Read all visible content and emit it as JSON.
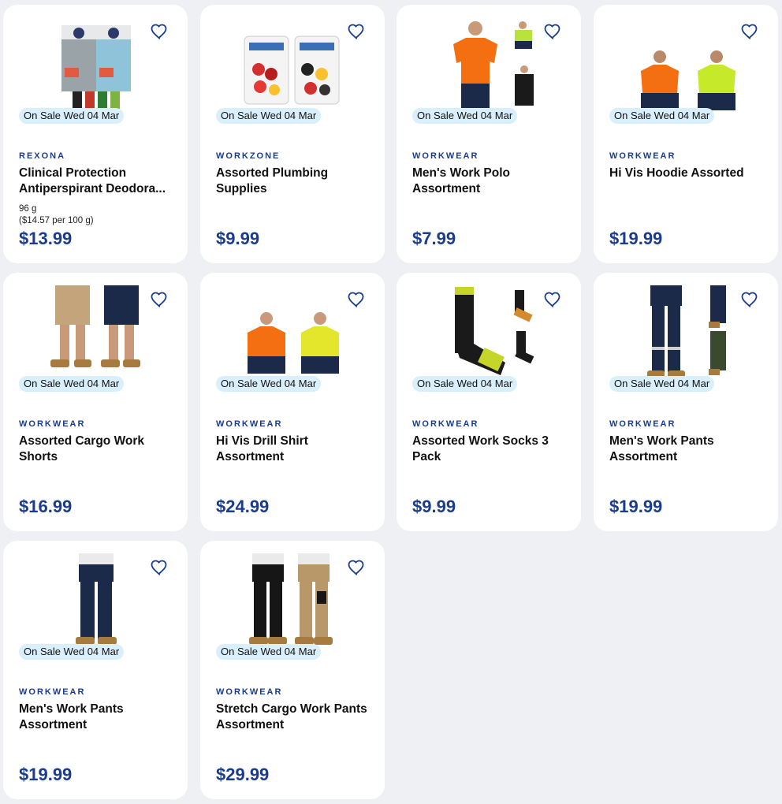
{
  "badge_text": "On Sale Wed 04 Mar",
  "products": [
    {
      "brand": "REXONA",
      "title": "Clinical Protection Antiperspirant Deodora...",
      "size": "96 g",
      "unit_price": "($14.57 per 100 g)",
      "price": "$13.99",
      "image": "deodorant-boxes"
    },
    {
      "brand": "WORKZONE",
      "title": "Assorted Plumbing Supplies",
      "price": "$9.99",
      "image": "tap-repair-kits"
    },
    {
      "brand": "WORKWEAR",
      "title": "Men's Work Polo Assortment",
      "price": "$7.99",
      "image": "hi-vis-polo"
    },
    {
      "brand": "WORKWEAR",
      "title": "Hi Vis Hoodie Assorted",
      "price": "$19.99",
      "image": "hi-vis-hoodies"
    },
    {
      "brand": "WORKWEAR",
      "title": "Assorted Cargo Work Shorts",
      "price": "$16.99",
      "image": "cargo-shorts"
    },
    {
      "brand": "WORKWEAR",
      "title": "Hi Vis Drill Shirt Assortment",
      "price": "$24.99",
      "image": "drill-shirts"
    },
    {
      "brand": "WORKWEAR",
      "title": "Assorted Work Socks 3 Pack",
      "price": "$9.99",
      "image": "work-socks"
    },
    {
      "brand": "WORKWEAR",
      "title": "Men's Work Pants Assortment",
      "price": "$19.99",
      "image": "work-pants-reflective"
    },
    {
      "brand": "WORKWEAR",
      "title": "Men's Work Pants Assortment",
      "price": "$19.99",
      "image": "work-pants-navy"
    },
    {
      "brand": "WORKWEAR",
      "title": "Stretch Cargo Work Pants Assortment",
      "price": "$29.99",
      "image": "stretch-cargo-pants"
    }
  ],
  "colors": {
    "brand_blue": "#1a3c8f",
    "badge_bg": "#d9effb",
    "card_bg": "#ffffff",
    "page_bg": "#eef0f3"
  },
  "icons": {
    "favourite": "heart-outline-icon"
  }
}
